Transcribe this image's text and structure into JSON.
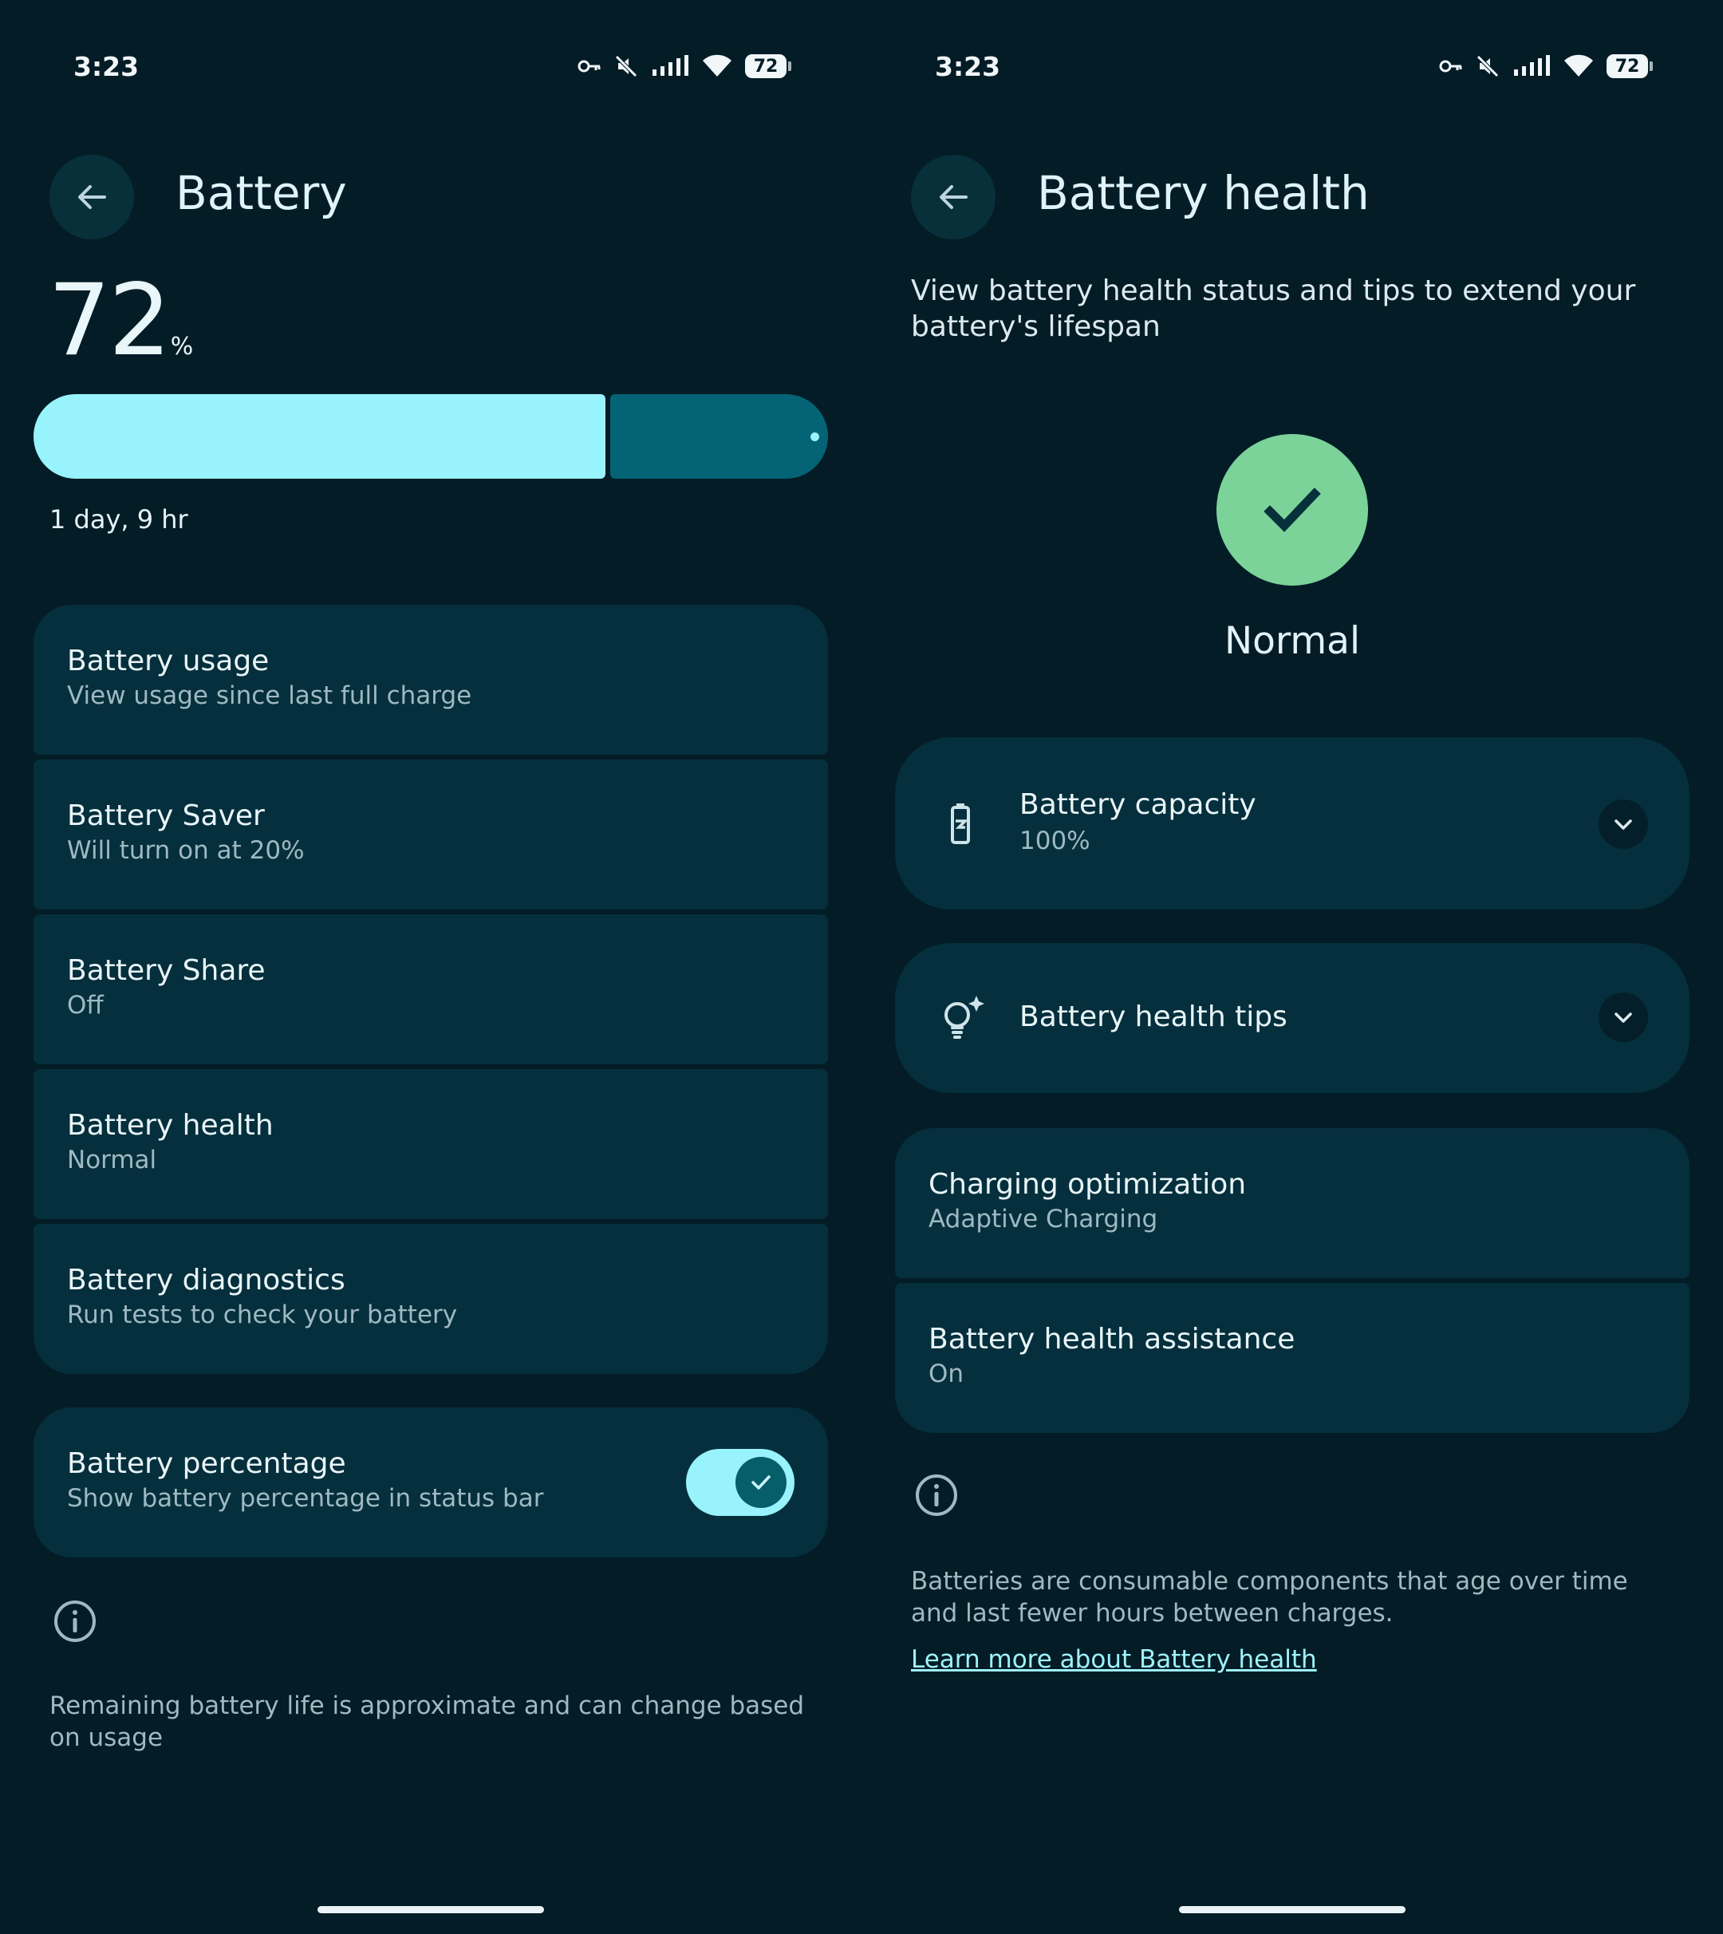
{
  "status": {
    "time": "3:23",
    "battery": "72"
  },
  "left": {
    "title": "Battery",
    "level_number": "72",
    "level_unit": "%",
    "level_fraction": 0.72,
    "time_remaining": "1 day, 9 hr",
    "items": [
      {
        "title": "Battery usage",
        "subtitle": "View usage since last full charge"
      },
      {
        "title": "Battery Saver",
        "subtitle": "Will turn on at 20%"
      },
      {
        "title": "Battery Share",
        "subtitle": "Off"
      },
      {
        "title": "Battery health",
        "subtitle": "Normal"
      },
      {
        "title": "Battery diagnostics",
        "subtitle": "Run tests to check your battery"
      }
    ],
    "percentage_toggle": {
      "title": "Battery percentage",
      "subtitle": "Show battery percentage in status bar",
      "on": true
    },
    "footer": "Remaining battery life is approximate and can change based on usage"
  },
  "right": {
    "title": "Battery health",
    "description": "View battery health status and tips to extend your battery's lifespan",
    "status_label": "Normal",
    "capacity": {
      "title": "Battery capacity",
      "value": "100%"
    },
    "tips": {
      "title": "Battery health tips"
    },
    "charging": {
      "title": "Charging optimization",
      "subtitle": "Adaptive Charging"
    },
    "assistance": {
      "title": "Battery health assistance",
      "subtitle": "On"
    },
    "footer": "Batteries are consumable components that age over time and last fewer hours between charges.",
    "link": "Learn more about Battery health"
  },
  "colors": {
    "accent": "#98f3fd",
    "background": "#031c26",
    "card": "#052f3c",
    "health_ok": "#7bd39a"
  },
  "icons": [
    "back-arrow-icon",
    "key-icon",
    "mute-icon",
    "signal-icon",
    "wifi-icon",
    "battery-icon",
    "info-icon",
    "battery-capacity-icon",
    "lightbulb-sparkle-icon",
    "chevron-down-icon",
    "check-icon"
  ]
}
